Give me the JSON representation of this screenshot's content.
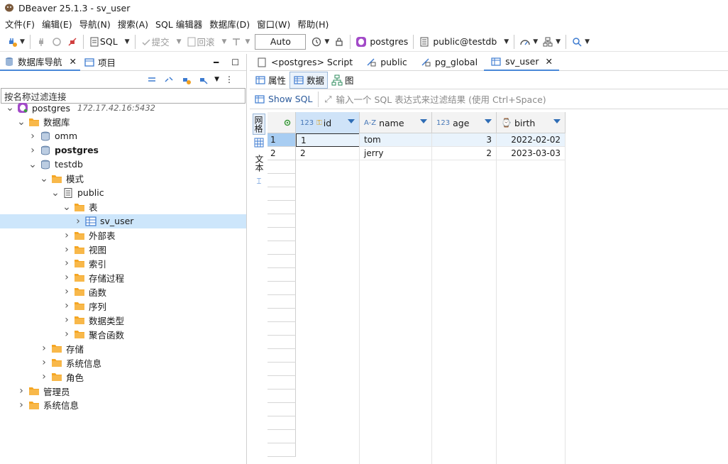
{
  "window": {
    "title": "DBeaver 25.1.3 - sv_user"
  },
  "menu": [
    "文件(F)",
    "编辑(E)",
    "导航(N)",
    "搜索(A)",
    "SQL 编辑器",
    "数据库(D)",
    "窗口(W)",
    "帮助(H)"
  ],
  "toolbar": {
    "sql_label": "SQL",
    "commit_label": "提交",
    "rollback_label": "回滚",
    "mode_value": "Auto",
    "connection": "postgres",
    "schema": "public@testdb"
  },
  "left_panel": {
    "tabs": [
      "数据库导航",
      "项目"
    ],
    "filter_placeholder": "按名称过滤连接",
    "tree": [
      {
        "label": "postgres",
        "hint": "172.17.42.16:5432",
        "level": 0,
        "exp": "open",
        "icon": "pg-icon"
      },
      {
        "label": "数据库",
        "level": 1,
        "exp": "open",
        "icon": "folder-icon"
      },
      {
        "label": "omm",
        "level": 2,
        "exp": "closed",
        "icon": "database-icon"
      },
      {
        "label": "postgres",
        "level": 2,
        "exp": "closed",
        "icon": "database-icon",
        "bold": true
      },
      {
        "label": "testdb",
        "level": 2,
        "exp": "open",
        "icon": "database-icon"
      },
      {
        "label": "模式",
        "level": 3,
        "exp": "open",
        "icon": "folder-icon"
      },
      {
        "label": "public",
        "level": 4,
        "exp": "open",
        "icon": "schema-icon"
      },
      {
        "label": "表",
        "level": 5,
        "exp": "open",
        "icon": "folder-icon"
      },
      {
        "label": "sv_user",
        "level": 6,
        "exp": "closed",
        "icon": "table-icon",
        "selected": true
      },
      {
        "label": "外部表",
        "level": 5,
        "exp": "closed",
        "icon": "folder-icon"
      },
      {
        "label": "视图",
        "level": 5,
        "exp": "closed",
        "icon": "folder-icon"
      },
      {
        "label": "索引",
        "level": 5,
        "exp": "closed",
        "icon": "folder-icon"
      },
      {
        "label": "存储过程",
        "level": 5,
        "exp": "closed",
        "icon": "folder-icon"
      },
      {
        "label": "函数",
        "level": 5,
        "exp": "closed",
        "icon": "folder-icon"
      },
      {
        "label": "序列",
        "level": 5,
        "exp": "closed",
        "icon": "folder-icon"
      },
      {
        "label": "数据类型",
        "level": 5,
        "exp": "closed",
        "icon": "folder-icon"
      },
      {
        "label": "聚合函数",
        "level": 5,
        "exp": "closed",
        "icon": "folder-icon"
      },
      {
        "label": "存储",
        "level": 3,
        "exp": "closed",
        "icon": "folder-icon"
      },
      {
        "label": "系统信息",
        "level": 3,
        "exp": "closed",
        "icon": "folder-icon"
      },
      {
        "label": "角色",
        "level": 3,
        "exp": "closed",
        "icon": "folder-icon"
      },
      {
        "label": "管理员",
        "level": 1,
        "exp": "closed",
        "icon": "folder-icon"
      },
      {
        "label": "系统信息",
        "level": 1,
        "exp": "closed",
        "icon": "folder-icon"
      }
    ]
  },
  "editor": {
    "tabs": [
      "<postgres> Script",
      "public",
      "pg_global",
      "sv_user"
    ],
    "subtabs": [
      "属性",
      "数据",
      "图"
    ],
    "show_sql": "Show SQL",
    "filter_placeholder": "输入一个 SQL 表达式来过滤结果 (使用 Ctrl+Space)",
    "vtabs": [
      "网格",
      "文本"
    ],
    "columns": [
      {
        "type": "123",
        "name": "id"
      },
      {
        "type": "A-Z",
        "name": "name"
      },
      {
        "type": "123",
        "name": "age"
      },
      {
        "type": "⌚",
        "name": "birth"
      }
    ],
    "rows": [
      {
        "n": "1",
        "cells": [
          "1",
          "tom",
          "3",
          "2022-02-02"
        ]
      },
      {
        "n": "2",
        "cells": [
          "2",
          "jerry",
          "2",
          "2023-03-03"
        ]
      }
    ]
  }
}
